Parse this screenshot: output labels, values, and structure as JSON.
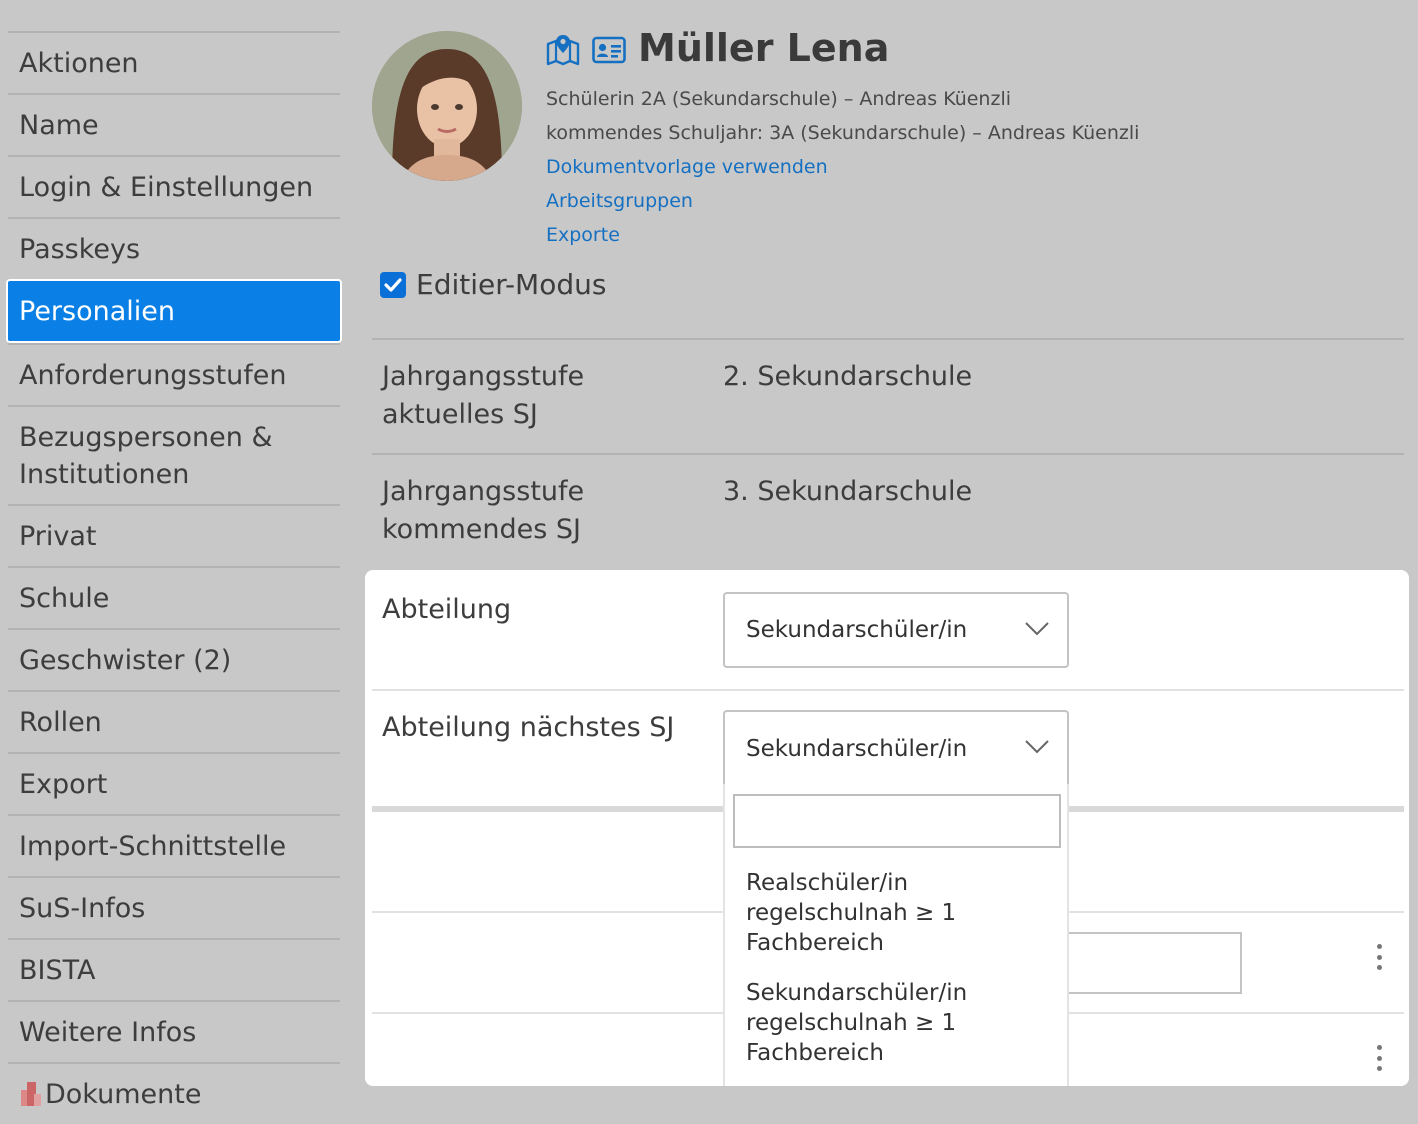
{
  "sidebar": {
    "items": [
      {
        "label": "Aktionen"
      },
      {
        "label": "Name"
      },
      {
        "label": "Login & Einstellungen"
      },
      {
        "label": "Passkeys"
      },
      {
        "label": "Personalien",
        "active": true
      },
      {
        "label": "Anforderungsstufen"
      },
      {
        "label": "Bezugspersonen & Institutionen"
      },
      {
        "label": "Privat"
      },
      {
        "label": "Schule"
      },
      {
        "label": "Geschwister (2)"
      },
      {
        "label": "Rollen"
      },
      {
        "label": "Export"
      },
      {
        "label": "Import-Schnittstelle"
      },
      {
        "label": "SuS-Infos"
      },
      {
        "label": "BISTA"
      },
      {
        "label": "Weitere Infos"
      },
      {
        "label": "Dokumente",
        "icon": "documents-icon"
      }
    ]
  },
  "header": {
    "name": "Müller Lena",
    "icons": [
      "map-location-icon",
      "id-card-icon"
    ],
    "subtitle1": "Schülerin 2A (Sekundarschule) – Andreas Küenzli",
    "subtitle2": "kommendes Schuljahr: 3A (Sekundarschule) – Andreas Küenzli",
    "links": [
      "Dokumentvorlage verwenden",
      "Arbeitsgruppen",
      "Exporte"
    ]
  },
  "edit_mode": {
    "label": "Editier-Modus",
    "checked": true
  },
  "fields": [
    {
      "label": "Jahrgangsstufe aktuelles SJ",
      "value": "2. Sekundarschule"
    },
    {
      "label": "Jahrgangsstufe kommendes SJ",
      "value": "3. Sekundarschule"
    }
  ],
  "form": {
    "abteilung": {
      "label": "Abteilung",
      "selected": "Sekundarschüler/in"
    },
    "abteilung_next": {
      "label": "Abteilung nächstes SJ",
      "selected": "Sekundarschüler/in"
    },
    "dropdown": {
      "search_value": "",
      "options": [
        "Realschüler/in regelschulnah ≥ 1 Fachbereich",
        "Sekundarschüler/in regelschulnah ≥ 1 Fachbereich"
      ]
    }
  },
  "colors": {
    "active_nav": "#0a7fe6",
    "link": "#1570c2",
    "checkbox": "#0a6fd6",
    "overlay_bg": "#c8c8c8"
  }
}
